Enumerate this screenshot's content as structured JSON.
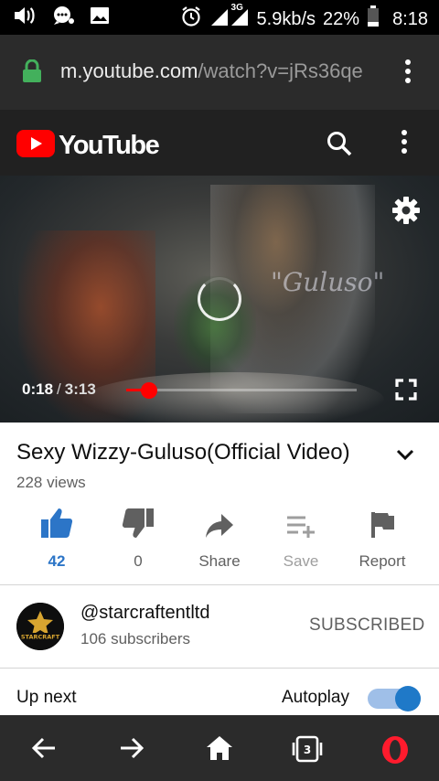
{
  "status_bar": {
    "speed": "5.9kb/s",
    "network": "3G",
    "battery": "22%",
    "time": "8:18",
    "icons": [
      "volume-icon",
      "chat-icon",
      "image-icon",
      "alarm-icon",
      "signal-icon",
      "battery-icon"
    ]
  },
  "browser": {
    "url_host": "m.youtube.com",
    "url_path": "/watch?v=jRs36qe",
    "icons": [
      "lock-icon",
      "menu-dots-icon"
    ]
  },
  "youtube": {
    "logo_text": "YouTube",
    "brand_color": "#ff0000",
    "icons": [
      "search-icon",
      "menu-dots-icon"
    ]
  },
  "player": {
    "watermark": "\"Guluso\"",
    "current_time": "0:18",
    "time_separator": "/",
    "duration": "3:13",
    "progress_fraction": 0.1,
    "icons": [
      "settings-icon",
      "loading-spinner-icon",
      "fullscreen-icon"
    ]
  },
  "video": {
    "title": "Sexy Wizzy-Guluso(Official Video)",
    "views": "228 views"
  },
  "actions": [
    {
      "name": "like",
      "label": "42",
      "icon": "thumbs-up-icon"
    },
    {
      "name": "dislike",
      "label": "0",
      "icon": "thumbs-down-icon"
    },
    {
      "name": "share",
      "label": "Share",
      "icon": "share-icon"
    },
    {
      "name": "save",
      "label": "Save",
      "icon": "playlist-add-icon"
    },
    {
      "name": "report",
      "label": "Report",
      "icon": "flag-icon"
    }
  ],
  "channel": {
    "name": "@starcraftentltd",
    "subscribers": "106 subscribers",
    "subscribe_state": "SUBSCRIBED",
    "avatar_text": "STARCRAFT"
  },
  "up_next": {
    "label": "Up next",
    "autoplay_label": "Autoplay",
    "autoplay_on": true,
    "accent": "#1f79c8"
  },
  "bottom_nav": {
    "tabs_count": "3",
    "icons": [
      "back-arrow-icon",
      "forward-arrow-icon",
      "home-icon",
      "tabs-icon",
      "opera-icon"
    ]
  }
}
